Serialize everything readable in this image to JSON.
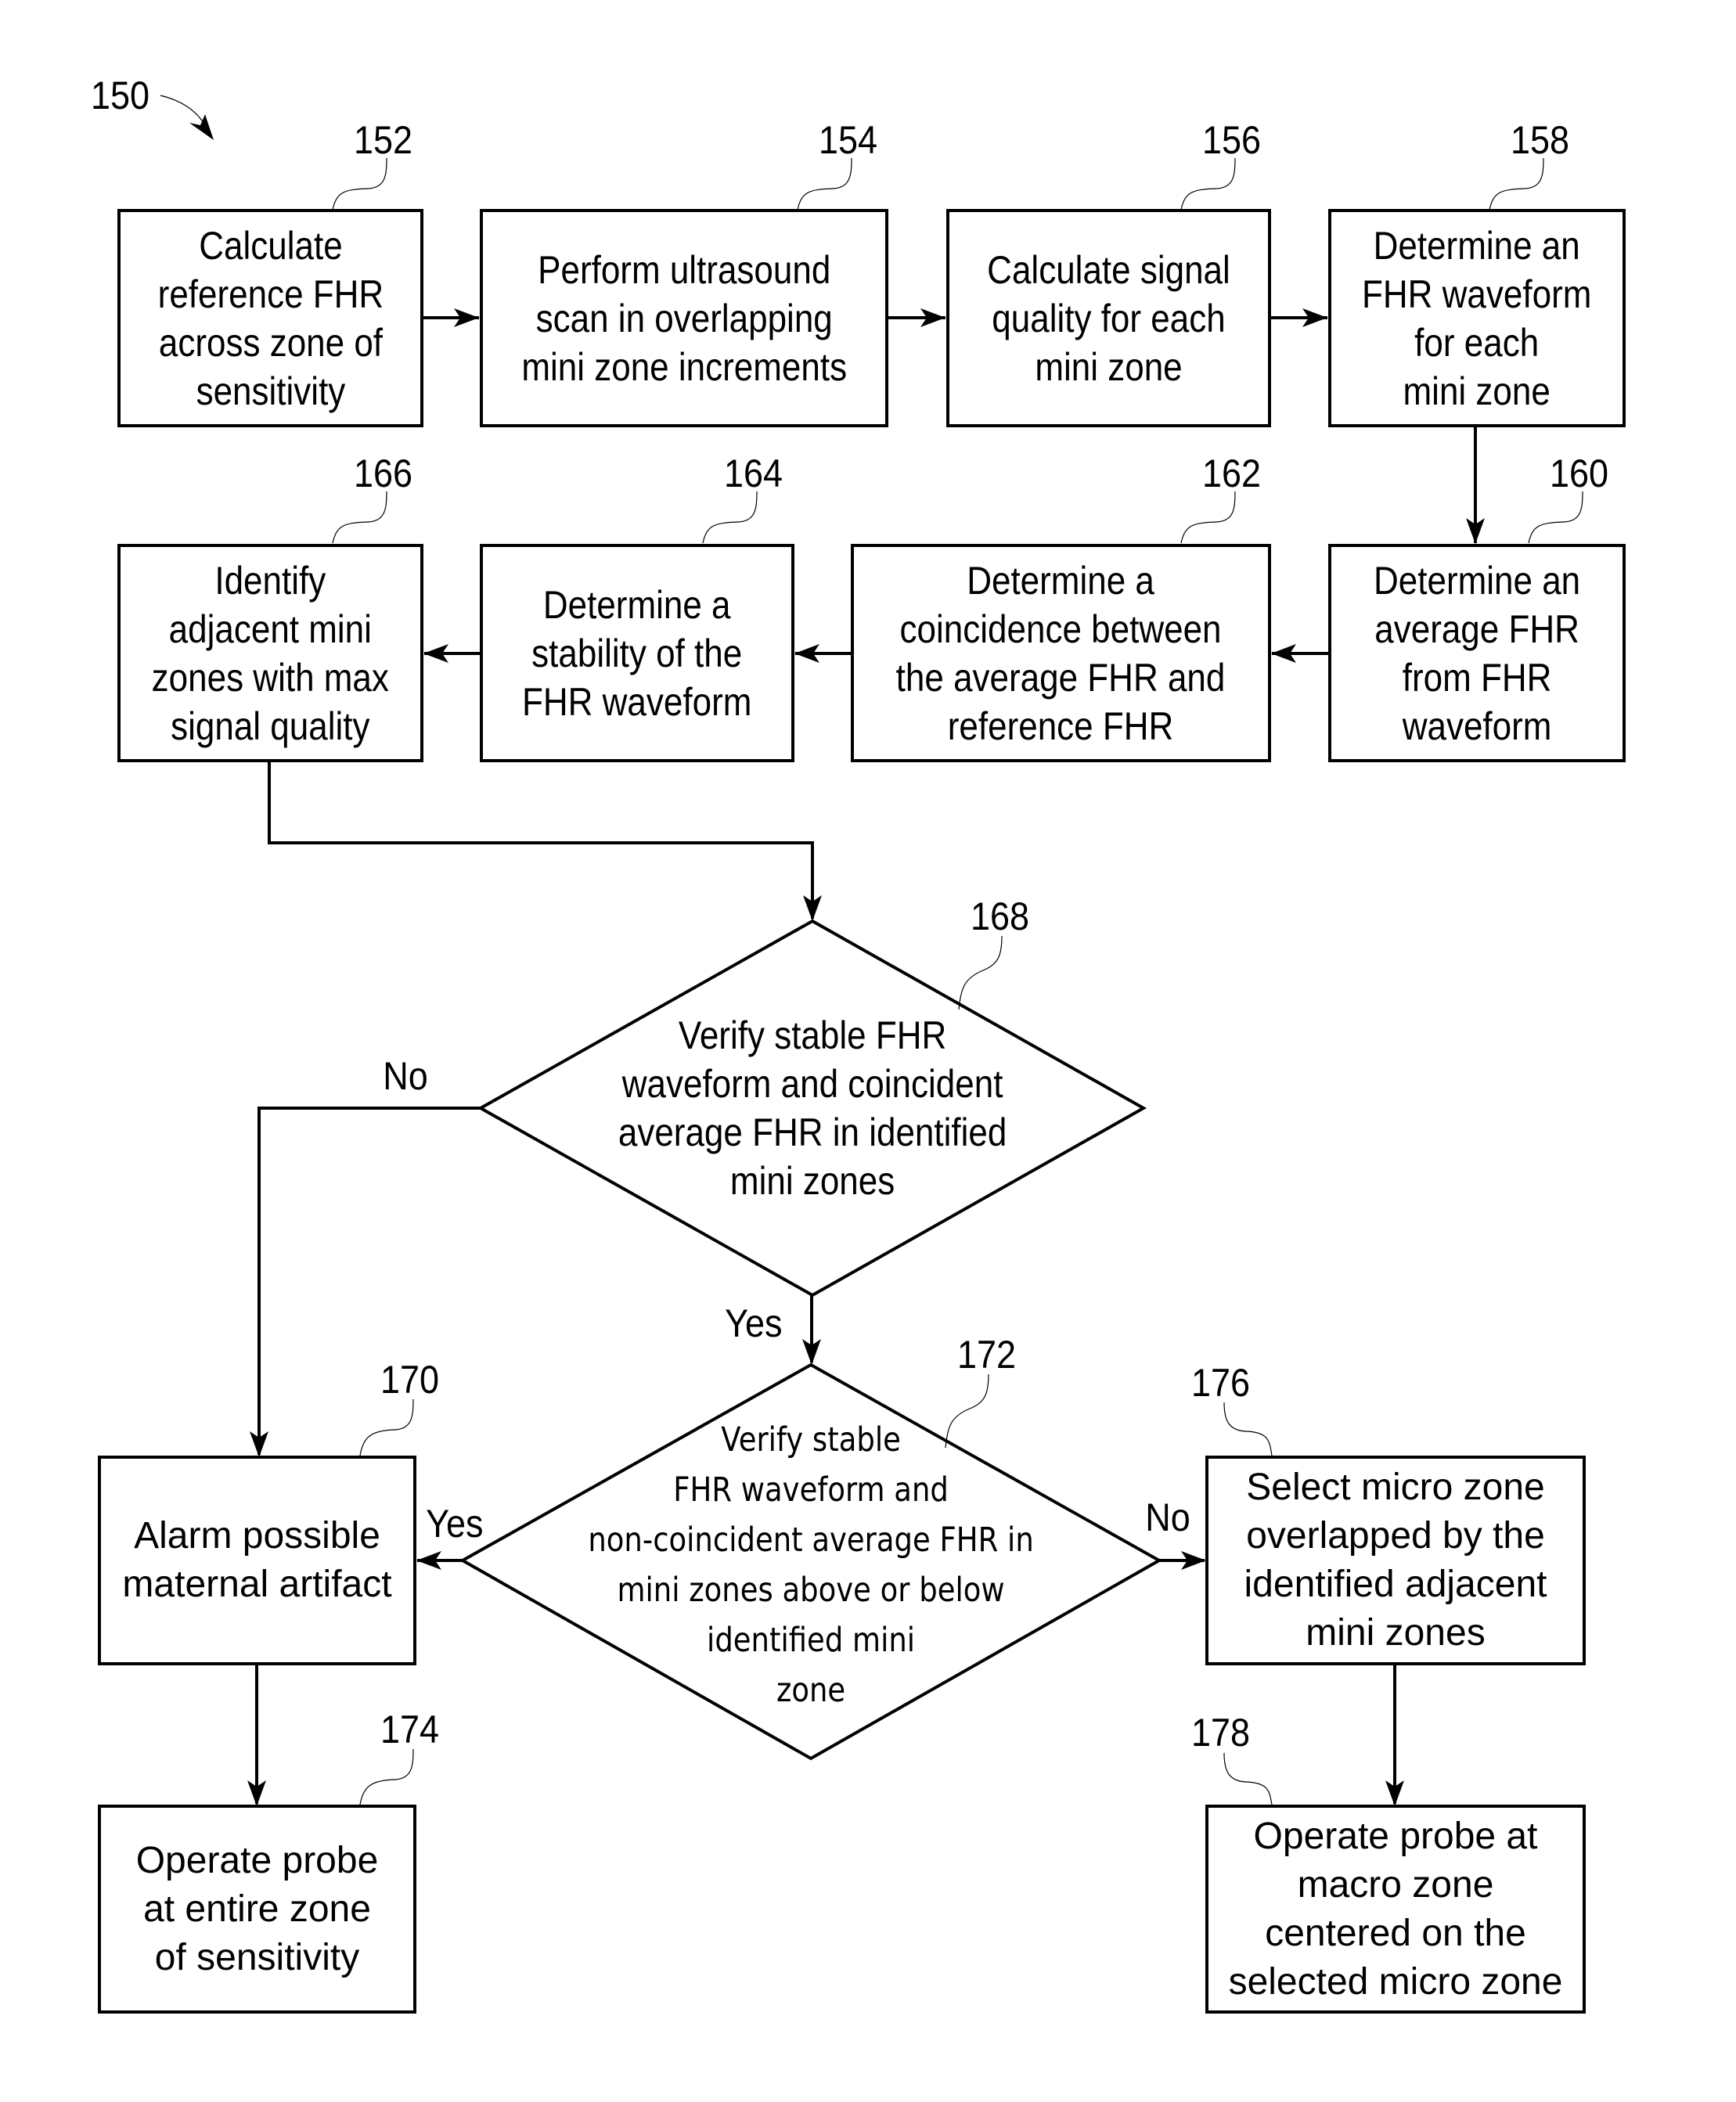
{
  "figure": {
    "ref": "150"
  },
  "steps": [
    {
      "id": "152",
      "ref": "152",
      "text": "Calculate\nreference FHR\nacross zone of\nsensitivity"
    },
    {
      "id": "154",
      "ref": "154",
      "text": "Perform ultrasound\nscan in overlapping\nmini zone increments"
    },
    {
      "id": "156",
      "ref": "156",
      "text": "Calculate signal\nquality for each\nmini zone"
    },
    {
      "id": "158",
      "ref": "158",
      "text": "Determine an\nFHR waveform\nfor each\nmini zone"
    },
    {
      "id": "160",
      "ref": "160",
      "text": "Determine an\naverage FHR\nfrom FHR\nwaveform"
    },
    {
      "id": "162",
      "ref": "162",
      "text": "Determine a\ncoincidence between\nthe average FHR and\nreference FHR"
    },
    {
      "id": "164",
      "ref": "164",
      "text": "Determine a\nstability of the\nFHR waveform"
    },
    {
      "id": "166",
      "ref": "166",
      "text": "Identify\nadjacent mini\nzones with max\nsignal quality"
    },
    {
      "id": "170",
      "ref": "170",
      "text": "Alarm possible\nmaternal artifact"
    },
    {
      "id": "174",
      "ref": "174",
      "text": "Operate probe\nat entire zone\n of sensitivity"
    },
    {
      "id": "176",
      "ref": "176",
      "text": "Select micro zone\noverlapped by the\nidentified adjacent\nmini zones"
    },
    {
      "id": "178",
      "ref": "178",
      "text": "Operate probe at\nmacro zone\ncentered on the\nselected micro zone"
    }
  ],
  "decisions": [
    {
      "id": "168",
      "ref": "168",
      "text": "Verify stable FHR\nwaveform and coincident\naverage FHR in identified\nmini zones",
      "yes_label": "Yes",
      "no_label": "No"
    },
    {
      "id": "172",
      "ref": "172",
      "text": "Verify stable\nFHR waveform and\nnon-coincident average FHR in\nmini zones above or below\nidentified mini\nzone",
      "yes_label": "Yes",
      "no_label": "No"
    }
  ]
}
